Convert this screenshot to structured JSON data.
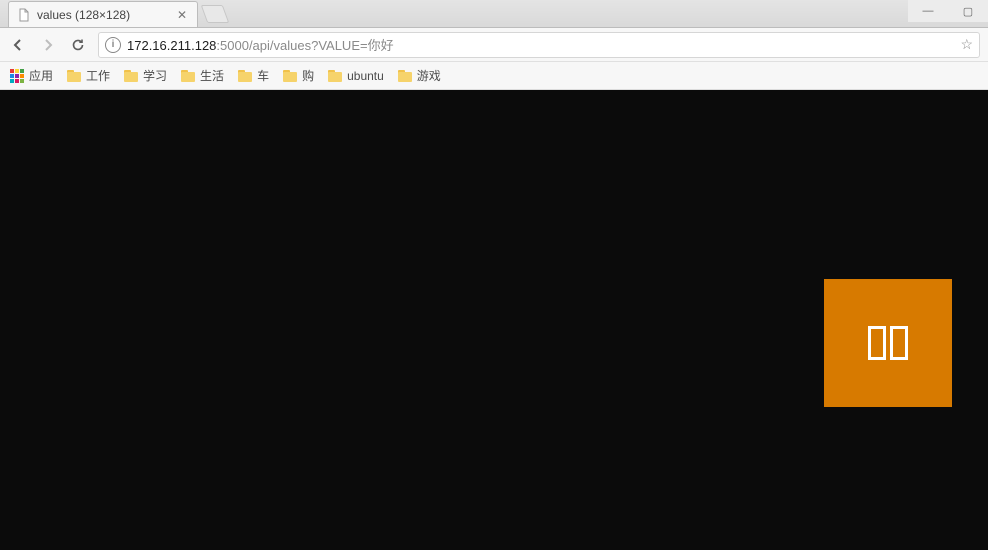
{
  "tab": {
    "title": "values (128×128)"
  },
  "url": {
    "host": "172.16.211.128",
    "rest": ":5000/api/values?VALUE=你好"
  },
  "bookmarks": {
    "apps_label": "应用",
    "items": [
      {
        "label": "工作"
      },
      {
        "label": "学习"
      },
      {
        "label": "生活"
      },
      {
        "label": "车"
      },
      {
        "label": "购"
      },
      {
        "label": "ubuntu"
      },
      {
        "label": "游戏"
      }
    ]
  },
  "content": {
    "image": {
      "width": 128,
      "height": 128,
      "bg_color": "#d77a00",
      "glyph_placeholder_count": 2
    }
  }
}
